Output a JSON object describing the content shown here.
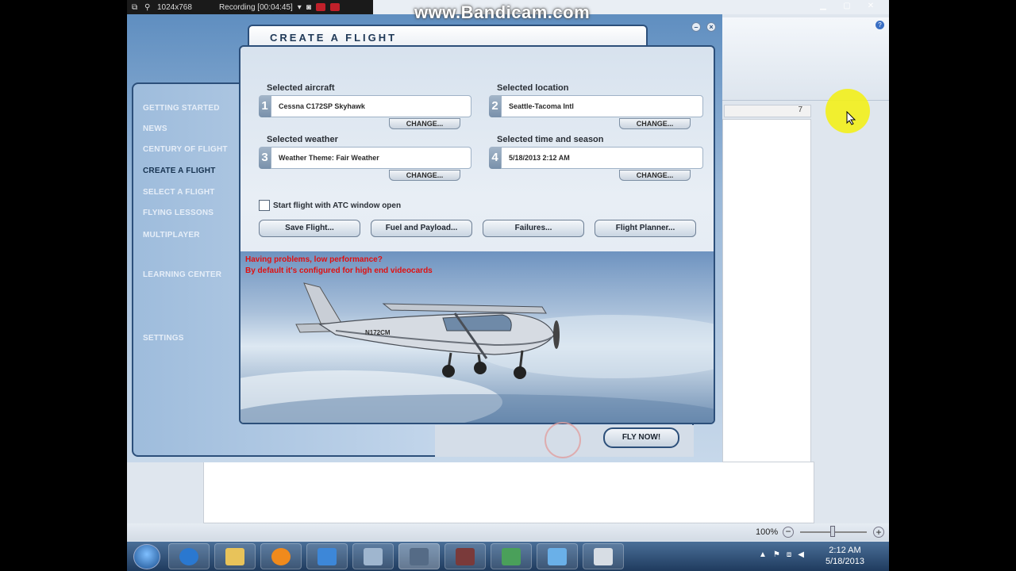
{
  "recording": {
    "resolution": "1024x768",
    "status": "Recording [00:04:45]"
  },
  "watermark": "www.Bandicam.com",
  "word": {
    "ruler_mark": "7",
    "zoom": "100%",
    "zoom_minus": "−",
    "zoom_plus": "+"
  },
  "fsx": {
    "title": "CREATE A FLIGHT",
    "nav": [
      {
        "label": "GETTING STARTED"
      },
      {
        "label": "NEWS"
      },
      {
        "label": "CENTURY OF FLIGHT"
      },
      {
        "label": "CREATE A FLIGHT"
      },
      {
        "label": "SELECT A FLIGHT"
      },
      {
        "label": "FLYING LESSONS"
      },
      {
        "label": "MULTIPLAYER"
      },
      {
        "label": "LEARNING CENTER"
      },
      {
        "label": "SETTINGS"
      }
    ],
    "aircraft": {
      "label": "Selected aircraft",
      "num": "1",
      "value": "Cessna C172SP Skyhawk",
      "change": "CHANGE..."
    },
    "location": {
      "label": "Selected location",
      "num": "2",
      "value": "Seattle-Tacoma Intl",
      "change": "CHANGE..."
    },
    "weather": {
      "label": "Selected weather",
      "num": "3",
      "value": "Weather Theme: Fair Weather",
      "change": "CHANGE..."
    },
    "time": {
      "label": "Selected time and season",
      "num": "4",
      "value": "5/18/2013 2:12 AM",
      "change": "CHANGE..."
    },
    "atc_label": "Start flight with ATC window open",
    "buttons": {
      "save": "Save Flight...",
      "fuel": "Fuel and Payload...",
      "failures": "Failures...",
      "planner": "Flight Planner..."
    },
    "warning_line1": "Having problems, low performance?",
    "warning_line2": "By default it's configured for high end videocards",
    "aircraft_reg": "N172CM",
    "fly_now": "FLY NOW!"
  },
  "taskbar": {
    "time": "2:12 AM",
    "date": "5/18/2013"
  },
  "colors": {
    "frame_blue": "#2c4f7a",
    "warning_red": "#e01010",
    "cursor_highlight": "#f3ef1a"
  }
}
